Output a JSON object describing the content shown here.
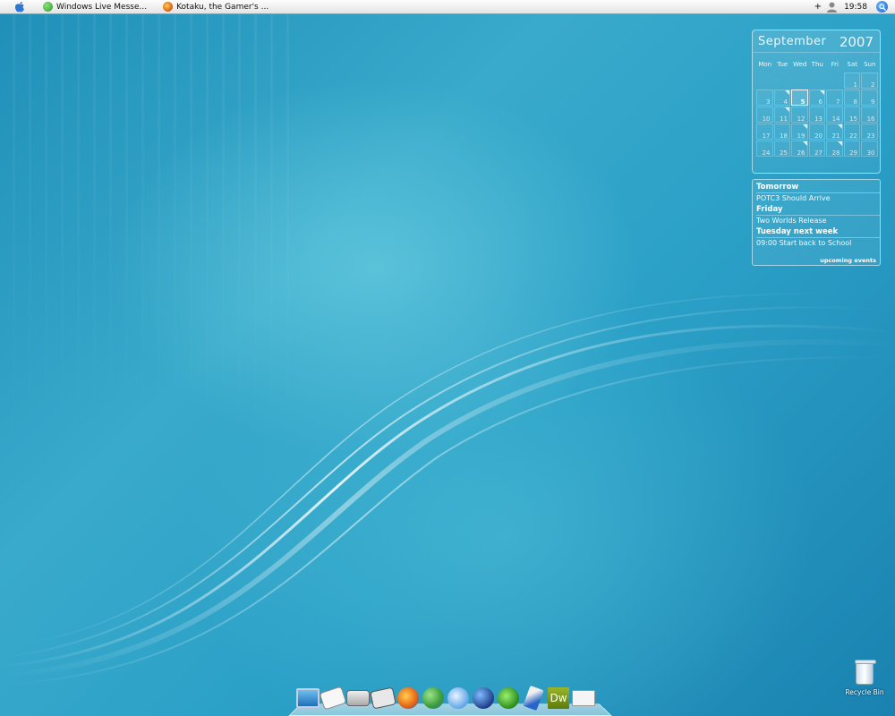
{
  "menubar": {
    "tasks": [
      {
        "label": "Windows Live Messe...",
        "icon": "msn-icon"
      },
      {
        "label": "Kotaku, the Gamer's ...",
        "icon": "firefox-icon"
      }
    ],
    "tray_plus": "+",
    "clock": "19:58"
  },
  "calendar": {
    "month": "September",
    "year": "2007",
    "weekdays": [
      "Mon",
      "Tue",
      "Wed",
      "Thu",
      "Fri",
      "Sat",
      "Sun"
    ],
    "leading_blanks": 5,
    "days": [
      "1",
      "2",
      "3",
      "4",
      "5",
      "6",
      "7",
      "8",
      "9",
      "10",
      "11",
      "12",
      "13",
      "14",
      "15",
      "16",
      "17",
      "18",
      "19",
      "20",
      "21",
      "22",
      "23",
      "24",
      "25",
      "26",
      "27",
      "28",
      "29",
      "30"
    ],
    "today": "5",
    "event_days": [
      "4",
      "6",
      "11",
      "19",
      "21",
      "26",
      "28"
    ]
  },
  "events": {
    "items": [
      {
        "when": "Tomorrow",
        "what": "POTC3 Should Arrive"
      },
      {
        "when": "Friday",
        "what": "Two Worlds Release"
      },
      {
        "when": "Tuesday next week",
        "what": "09:00 Start back to School"
      }
    ],
    "footer": "upcoming events"
  },
  "dock": {
    "icons": [
      "monitor-icon",
      "document-icon",
      "printer-icon",
      "tools-icon",
      "firefox-icon",
      "messenger-icon",
      "itunes-icon",
      "globe-icon",
      "utorrent-icon",
      "feather-icon",
      "dreamweaver-icon",
      "mail-icon"
    ],
    "dreamweaver_text": "Dw"
  },
  "desktop": {
    "recycle_bin_label": "Recycle Bin"
  }
}
